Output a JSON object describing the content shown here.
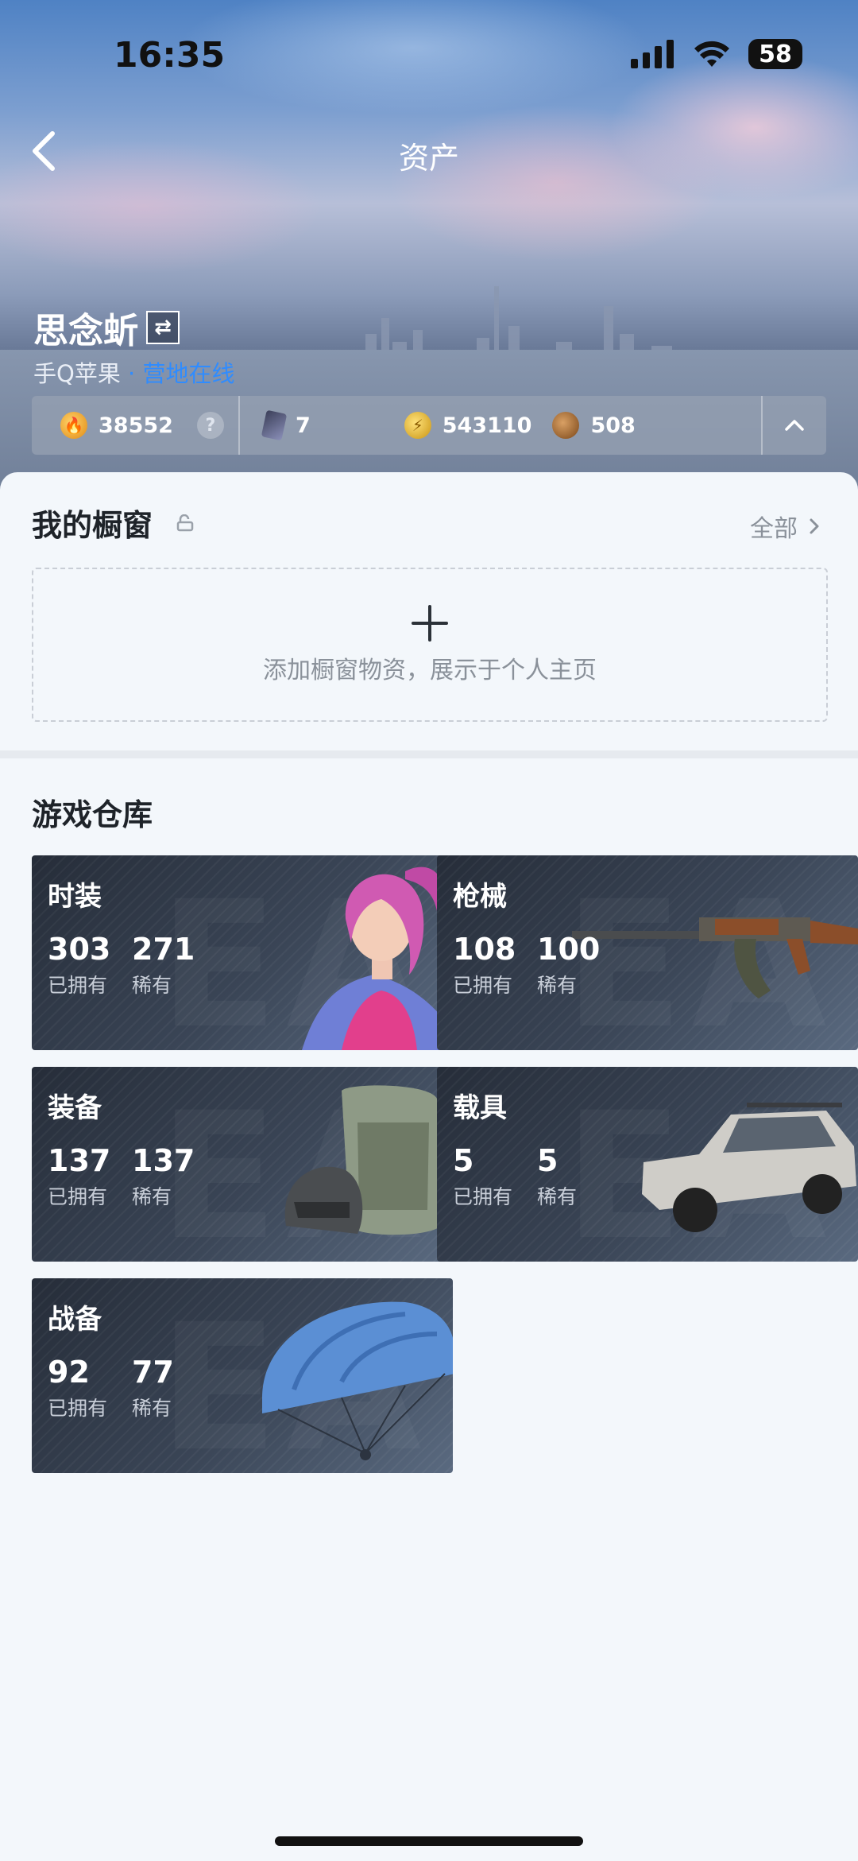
{
  "status_bar": {
    "time": "16:35",
    "battery": "58"
  },
  "header": {
    "title": "资产"
  },
  "profile": {
    "name": "思念蚚",
    "platform": "手Q苹果",
    "separator": " · ",
    "online_status": "营地在线"
  },
  "currencies": [
    {
      "icon": "flame-coin-icon",
      "value": "38552",
      "has_help": true
    },
    {
      "icon": "card-icon",
      "value": "7"
    },
    {
      "icon": "gold-coin-icon",
      "value": "543110"
    },
    {
      "icon": "bronze-coin-icon",
      "value": "508"
    }
  ],
  "showcase": {
    "title": "我的橱窗",
    "see_all": "全部",
    "empty_text": "添加橱窗物资，展示于个人主页"
  },
  "warehouse": {
    "title": "游戏仓库",
    "owned_label": "已拥有",
    "rare_label": "稀有",
    "categories": [
      {
        "name": "时装",
        "owned": "303",
        "rare": "271"
      },
      {
        "name": "枪械",
        "owned": "108",
        "rare": "100"
      },
      {
        "name": "装备",
        "owned": "137",
        "rare": "137"
      },
      {
        "name": "载具",
        "owned": "5",
        "rare": "5"
      },
      {
        "name": "战备",
        "owned": "92",
        "rare": "77"
      }
    ]
  }
}
